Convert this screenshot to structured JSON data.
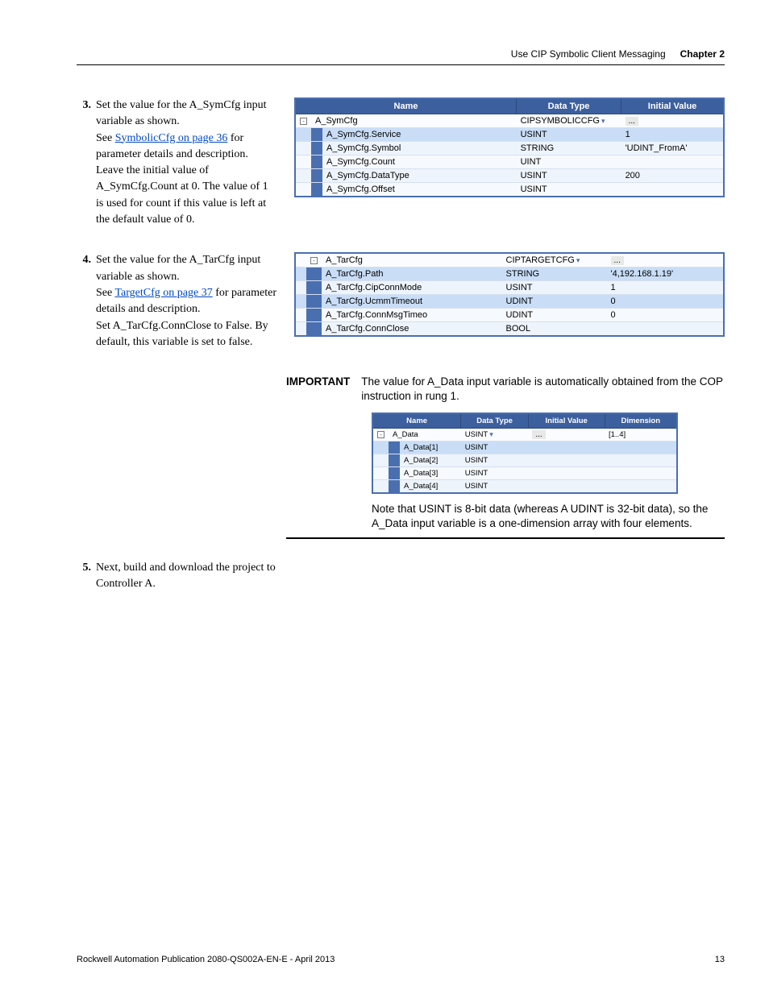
{
  "header": {
    "section_title": "Use CIP Symbolic Client Messaging",
    "chapter": "Chapter 2"
  },
  "steps": {
    "s3": {
      "num": "3.",
      "t1": "Set the value for the A_SymCfg input variable as shown.",
      "t2a": "See ",
      "link": "SymbolicCfg on page 36",
      "t2b": " for parameter details and description.",
      "t3": "Leave the initial value of A_SymCfg.Count at 0. The value of 1 is used for count if this value is left at the default value of 0."
    },
    "s4": {
      "num": "4.",
      "t1": "Set the value for the A_TarCfg input variable as shown.",
      "t2a": "See ",
      "link": "TargetCfg on page 37",
      "t2b": " for parameter details and description.",
      "t3": "Set A_TarCfg.ConnClose to False. By default, this variable is set to false."
    },
    "s5": {
      "num": "5.",
      "t1": "Next, build and download the project to Controller A."
    }
  },
  "table1": {
    "headers": {
      "name": "Name",
      "type": "Data Type",
      "value": "Initial Value"
    },
    "parent": {
      "name": "A_SymCfg",
      "type": "CIPSYMBOLICCFG",
      "value": "..."
    },
    "rows": [
      {
        "name": "A_SymCfg.Service",
        "type": "USINT",
        "value": "1"
      },
      {
        "name": "A_SymCfg.Symbol",
        "type": "STRING",
        "value": "'UDINT_FromA'"
      },
      {
        "name": "A_SymCfg.Count",
        "type": "UINT",
        "value": ""
      },
      {
        "name": "A_SymCfg.DataType",
        "type": "USINT",
        "value": "200"
      },
      {
        "name": "A_SymCfg.Offset",
        "type": "USINT",
        "value": ""
      }
    ]
  },
  "table2": {
    "parent": {
      "name": "A_TarCfg",
      "type": "CIPTARGETCFG",
      "value": "..."
    },
    "rows": [
      {
        "name": "A_TarCfg.Path",
        "type": "STRING",
        "value": "'4,192.168.1.19'"
      },
      {
        "name": "A_TarCfg.CipConnMode",
        "type": "USINT",
        "value": "1"
      },
      {
        "name": "A_TarCfg.UcmmTimeout",
        "type": "UDINT",
        "value": "0"
      },
      {
        "name": "A_TarCfg.ConnMsgTimeo",
        "type": "UDINT",
        "value": "0"
      },
      {
        "name": "A_TarCfg.ConnClose",
        "type": "BOOL",
        "value": ""
      }
    ]
  },
  "important": {
    "label": "IMPORTANT",
    "body": "The value for A_Data input variable is automatically obtained from the COP instruction in rung 1.",
    "note": "Note that USINT is 8-bit data (whereas A UDINT is 32-bit data), so the A_Data input variable is a one-dimension array with four elements."
  },
  "table3": {
    "headers": {
      "name": "Name",
      "type": "Data Type",
      "value": "Initial Value",
      "dim": "Dimension"
    },
    "parent": {
      "name": "A_Data",
      "type": "USINT",
      "value": "...",
      "dim": "[1..4]"
    },
    "rows": [
      {
        "name": "A_Data[1]",
        "type": "USINT"
      },
      {
        "name": "A_Data[2]",
        "type": "USINT"
      },
      {
        "name": "A_Data[3]",
        "type": "USINT"
      },
      {
        "name": "A_Data[4]",
        "type": "USINT"
      }
    ]
  },
  "footer": {
    "pub": "Rockwell Automation Publication 2080-QS002A-EN-E - April 2013",
    "page": "13"
  }
}
